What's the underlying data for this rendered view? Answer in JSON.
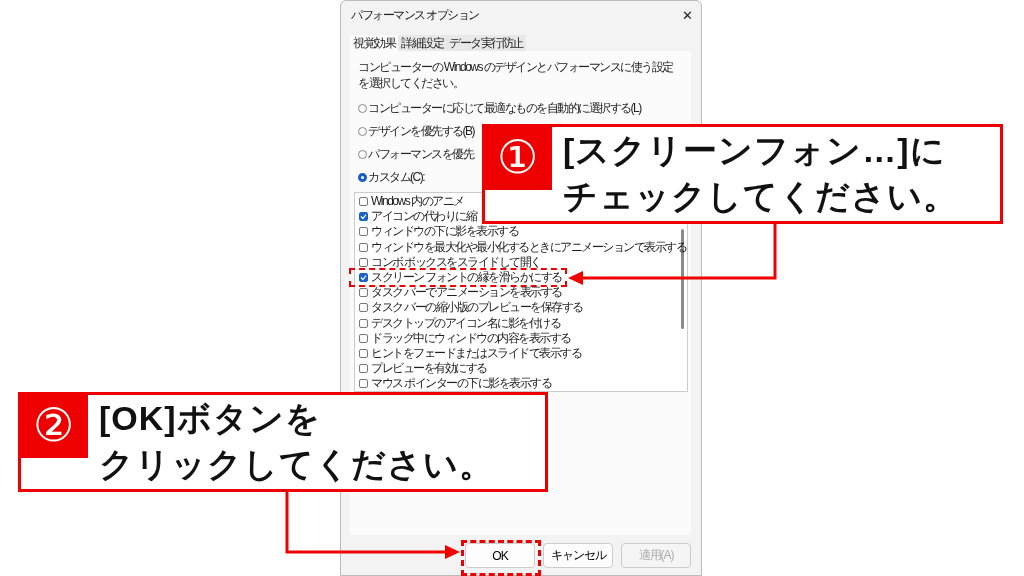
{
  "window": {
    "title": "パフォーマンス オプション",
    "close": "✕"
  },
  "tabs": [
    {
      "label": "視覚効果",
      "selected": true
    },
    {
      "label": "詳細設定",
      "selected": false
    },
    {
      "label": "データ実行防止",
      "selected": false
    }
  ],
  "description": "コンピューターの Windows のデザインとパフォーマンスに使う設定を選択してください。",
  "radios": [
    {
      "label": "コンピューターに応じて最適なものを自動的に選択する(L)",
      "selected": false
    },
    {
      "label": "デザインを優先する(B)",
      "selected": false
    },
    {
      "label": "パフォーマンスを優先",
      "selected": false
    },
    {
      "label": "カスタム(C):",
      "selected": true
    }
  ],
  "effects": [
    {
      "label": "Windows 内のアニメ",
      "checked": false,
      "highlighted": false
    },
    {
      "label": "アイコンの代わりに縮",
      "checked": true,
      "highlighted": false
    },
    {
      "label": "ウィンドウの下に影を表示する",
      "checked": false,
      "highlighted": false
    },
    {
      "label": "ウィンドウを最大化や最小化するときにアニメーションで表示する",
      "checked": false,
      "highlighted": false
    },
    {
      "label": "コンボ ボックスをスライドして開く",
      "checked": false,
      "highlighted": false
    },
    {
      "label": "スクリーン フォントの縁を滑らかにする",
      "checked": true,
      "highlighted": true
    },
    {
      "label": "タスク バーでアニメーションを表示する",
      "checked": false,
      "highlighted": false
    },
    {
      "label": "タスク バーの縮小版のプレビューを保存する",
      "checked": false,
      "highlighted": false
    },
    {
      "label": "デスクトップのアイコン名に影を付ける",
      "checked": false,
      "highlighted": false
    },
    {
      "label": "ドラッグ中にウィンドウの内容を表示する",
      "checked": false,
      "highlighted": false
    },
    {
      "label": "ヒントをフェードまたはスライドで表示する",
      "checked": false,
      "highlighted": false
    },
    {
      "label": "プレビューを有効にする",
      "checked": false,
      "highlighted": false
    },
    {
      "label": "マウス ポインターの下に影を表示する",
      "checked": false,
      "highlighted": false
    }
  ],
  "buttons": [
    {
      "label": "OK",
      "disabled": false,
      "highlighted": true
    },
    {
      "label": "キャンセル",
      "disabled": false,
      "highlighted": false
    },
    {
      "label": "適用(A)",
      "disabled": true,
      "highlighted": false
    }
  ],
  "annotations": [
    {
      "number": "①",
      "lines": [
        "[スクリーンフォン…]に",
        "チェックしてください。"
      ]
    },
    {
      "number": "②",
      "lines": [
        "[OK]ボタンを",
        "クリックしてください。"
      ]
    }
  ]
}
